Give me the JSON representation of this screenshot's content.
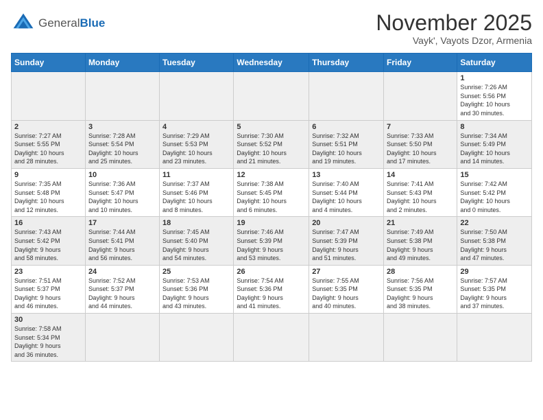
{
  "header": {
    "logo": {
      "general": "General",
      "blue": "Blue"
    },
    "title": "November 2025",
    "subtitle": "Vayk', Vayots Dzor, Armenia"
  },
  "days_of_week": [
    "Sunday",
    "Monday",
    "Tuesday",
    "Wednesday",
    "Thursday",
    "Friday",
    "Saturday"
  ],
  "weeks": [
    [
      {
        "day": "",
        "info": ""
      },
      {
        "day": "",
        "info": ""
      },
      {
        "day": "",
        "info": ""
      },
      {
        "day": "",
        "info": ""
      },
      {
        "day": "",
        "info": ""
      },
      {
        "day": "",
        "info": ""
      },
      {
        "day": "1",
        "info": "Sunrise: 7:26 AM\nSunset: 5:56 PM\nDaylight: 10 hours\nand 30 minutes."
      }
    ],
    [
      {
        "day": "2",
        "info": "Sunrise: 7:27 AM\nSunset: 5:55 PM\nDaylight: 10 hours\nand 28 minutes."
      },
      {
        "day": "3",
        "info": "Sunrise: 7:28 AM\nSunset: 5:54 PM\nDaylight: 10 hours\nand 25 minutes."
      },
      {
        "day": "4",
        "info": "Sunrise: 7:29 AM\nSunset: 5:53 PM\nDaylight: 10 hours\nand 23 minutes."
      },
      {
        "day": "5",
        "info": "Sunrise: 7:30 AM\nSunset: 5:52 PM\nDaylight: 10 hours\nand 21 minutes."
      },
      {
        "day": "6",
        "info": "Sunrise: 7:32 AM\nSunset: 5:51 PM\nDaylight: 10 hours\nand 19 minutes."
      },
      {
        "day": "7",
        "info": "Sunrise: 7:33 AM\nSunset: 5:50 PM\nDaylight: 10 hours\nand 17 minutes."
      },
      {
        "day": "8",
        "info": "Sunrise: 7:34 AM\nSunset: 5:49 PM\nDaylight: 10 hours\nand 14 minutes."
      }
    ],
    [
      {
        "day": "9",
        "info": "Sunrise: 7:35 AM\nSunset: 5:48 PM\nDaylight: 10 hours\nand 12 minutes."
      },
      {
        "day": "10",
        "info": "Sunrise: 7:36 AM\nSunset: 5:47 PM\nDaylight: 10 hours\nand 10 minutes."
      },
      {
        "day": "11",
        "info": "Sunrise: 7:37 AM\nSunset: 5:46 PM\nDaylight: 10 hours\nand 8 minutes."
      },
      {
        "day": "12",
        "info": "Sunrise: 7:38 AM\nSunset: 5:45 PM\nDaylight: 10 hours\nand 6 minutes."
      },
      {
        "day": "13",
        "info": "Sunrise: 7:40 AM\nSunset: 5:44 PM\nDaylight: 10 hours\nand 4 minutes."
      },
      {
        "day": "14",
        "info": "Sunrise: 7:41 AM\nSunset: 5:43 PM\nDaylight: 10 hours\nand 2 minutes."
      },
      {
        "day": "15",
        "info": "Sunrise: 7:42 AM\nSunset: 5:42 PM\nDaylight: 10 hours\nand 0 minutes."
      }
    ],
    [
      {
        "day": "16",
        "info": "Sunrise: 7:43 AM\nSunset: 5:42 PM\nDaylight: 9 hours\nand 58 minutes."
      },
      {
        "day": "17",
        "info": "Sunrise: 7:44 AM\nSunset: 5:41 PM\nDaylight: 9 hours\nand 56 minutes."
      },
      {
        "day": "18",
        "info": "Sunrise: 7:45 AM\nSunset: 5:40 PM\nDaylight: 9 hours\nand 54 minutes."
      },
      {
        "day": "19",
        "info": "Sunrise: 7:46 AM\nSunset: 5:39 PM\nDaylight: 9 hours\nand 53 minutes."
      },
      {
        "day": "20",
        "info": "Sunrise: 7:47 AM\nSunset: 5:39 PM\nDaylight: 9 hours\nand 51 minutes."
      },
      {
        "day": "21",
        "info": "Sunrise: 7:49 AM\nSunset: 5:38 PM\nDaylight: 9 hours\nand 49 minutes."
      },
      {
        "day": "22",
        "info": "Sunrise: 7:50 AM\nSunset: 5:38 PM\nDaylight: 9 hours\nand 47 minutes."
      }
    ],
    [
      {
        "day": "23",
        "info": "Sunrise: 7:51 AM\nSunset: 5:37 PM\nDaylight: 9 hours\nand 46 minutes."
      },
      {
        "day": "24",
        "info": "Sunrise: 7:52 AM\nSunset: 5:37 PM\nDaylight: 9 hours\nand 44 minutes."
      },
      {
        "day": "25",
        "info": "Sunrise: 7:53 AM\nSunset: 5:36 PM\nDaylight: 9 hours\nand 43 minutes."
      },
      {
        "day": "26",
        "info": "Sunrise: 7:54 AM\nSunset: 5:36 PM\nDaylight: 9 hours\nand 41 minutes."
      },
      {
        "day": "27",
        "info": "Sunrise: 7:55 AM\nSunset: 5:35 PM\nDaylight: 9 hours\nand 40 minutes."
      },
      {
        "day": "28",
        "info": "Sunrise: 7:56 AM\nSunset: 5:35 PM\nDaylight: 9 hours\nand 38 minutes."
      },
      {
        "day": "29",
        "info": "Sunrise: 7:57 AM\nSunset: 5:35 PM\nDaylight: 9 hours\nand 37 minutes."
      }
    ],
    [
      {
        "day": "30",
        "info": "Sunrise: 7:58 AM\nSunset: 5:34 PM\nDaylight: 9 hours\nand 36 minutes."
      },
      {
        "day": "",
        "info": ""
      },
      {
        "day": "",
        "info": ""
      },
      {
        "day": "",
        "info": ""
      },
      {
        "day": "",
        "info": ""
      },
      {
        "day": "",
        "info": ""
      },
      {
        "day": "",
        "info": ""
      }
    ]
  ]
}
